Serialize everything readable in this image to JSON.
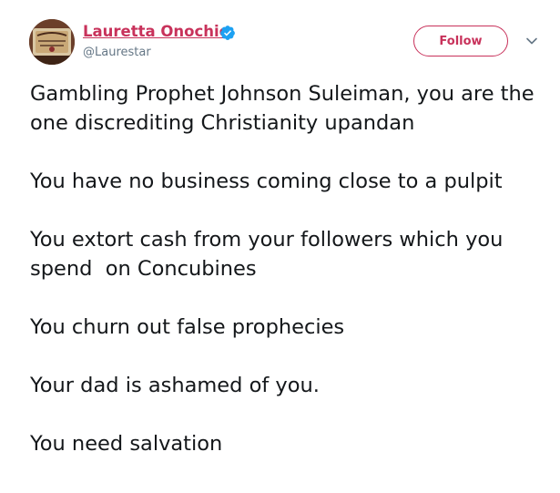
{
  "user": {
    "name": "Lauretta Onochie",
    "handle": "@Laurestar",
    "verified_icon": "verified-badge-icon",
    "avatar_icon": "avatar-image"
  },
  "actions": {
    "follow_label": "Follow",
    "caret_icon": "chevron-down-icon"
  },
  "tweet": {
    "paragraphs": [
      "Gambling Prophet Johnson Suleiman, you are the one discrediting Christianity upandan",
      "You have no business coming close to a pulpit",
      "You extort cash from your followers which you spend  on Concubines",
      "You churn out false prophecies",
      "Your dad is ashamed of you.",
      "You need salvation"
    ]
  },
  "colors": {
    "name_accent": "#c8325b",
    "verified_blue": "#1da1f2",
    "text": "#14171a",
    "muted": "#657786"
  }
}
